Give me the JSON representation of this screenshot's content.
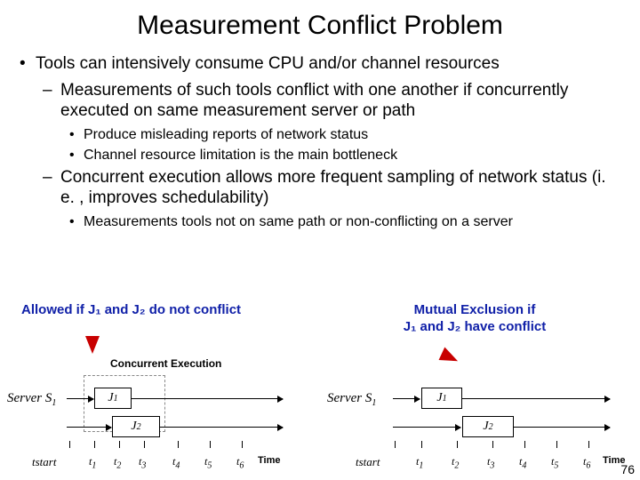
{
  "title": "Measurement Conflict Problem",
  "bullets": {
    "b1": "Tools can intensively consume CPU and/or channel resources",
    "b1a": "Measurements of such tools conflict with one another if concurrently executed on same measurement server or path",
    "b1a1": "Produce misleading reports of network status",
    "b1a2": "Channel resource limitation is the main bottleneck",
    "b1b": "Concurrent execution allows more frequent sampling of network status (i. e. , improves schedulability)",
    "b1b1": "Measurements tools not on same path or non-conflicting on a server"
  },
  "left": {
    "caption": "Allowed if J₁ and J₂ do not conflict",
    "exec": "Concurrent Execution",
    "server": "Server S",
    "server_sub": "1",
    "j1": "J",
    "j1sub": "1",
    "j2": "J",
    "j2sub": "2",
    "tstart": "t",
    "tstart_sub": "start",
    "ticks": [
      "1",
      "2",
      "3",
      "4",
      "5",
      "6"
    ],
    "time": "Time"
  },
  "right": {
    "caption_l1": "Mutual Exclusion if",
    "caption_l2": "J₁ and J₂ have conflict",
    "server": "Server S",
    "server_sub": "1",
    "j1": "J",
    "j1sub": "1",
    "j2": "J",
    "j2sub": "2",
    "tstart": "t",
    "tstart_sub": "start",
    "ticks": [
      "1",
      "2",
      "3",
      "4",
      "5",
      "6"
    ],
    "time": "Time"
  },
  "page": "76"
}
